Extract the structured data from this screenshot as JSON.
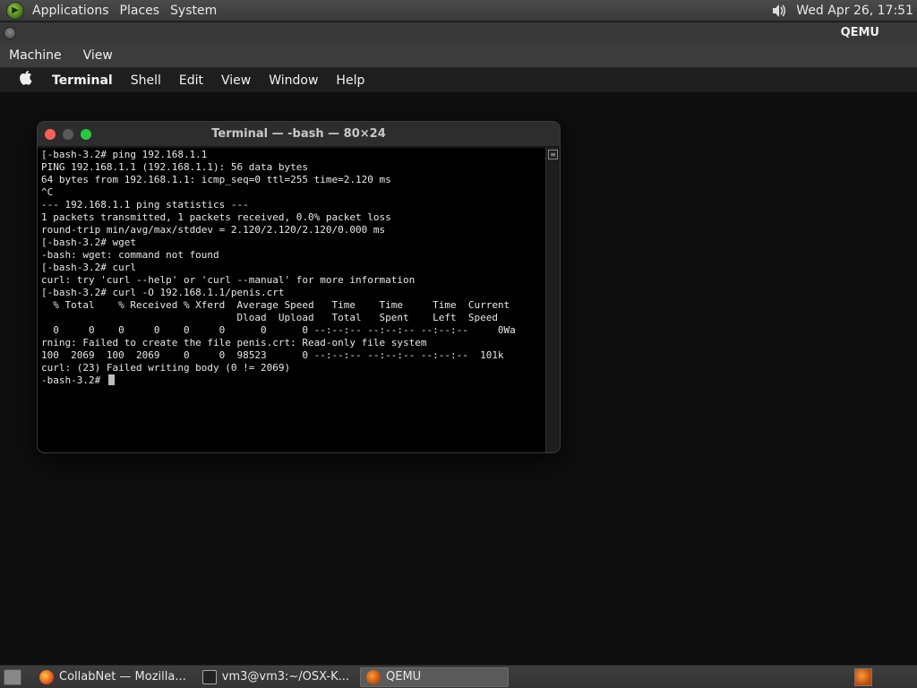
{
  "gnome_panel": {
    "menus": [
      "Applications",
      "Places",
      "System"
    ],
    "clock": "Wed Apr 26, 17:51"
  },
  "qemu": {
    "title": "QEMU",
    "menu": [
      "Machine",
      "View"
    ]
  },
  "mac_menubar": {
    "app_name": "Terminal",
    "items": [
      "Shell",
      "Edit",
      "Window",
      "Help"
    ],
    "view_label": "View"
  },
  "terminal": {
    "title": "Terminal — -bash — 80×24",
    "output": "[-bash-3.2# ping 192.168.1.1\nPING 192.168.1.1 (192.168.1.1): 56 data bytes\n64 bytes from 192.168.1.1: icmp_seq=0 ttl=255 time=2.120 ms\n^C\n--- 192.168.1.1 ping statistics ---\n1 packets transmitted, 1 packets received, 0.0% packet loss\nround-trip min/avg/max/stddev = 2.120/2.120/2.120/0.000 ms\n[-bash-3.2# wget\n-bash: wget: command not found\n[-bash-3.2# curl\ncurl: try 'curl --help' or 'curl --manual' for more information\n[-bash-3.2# curl -O 192.168.1.1/penis.crt\n  % Total    % Received % Xferd  Average Speed   Time    Time     Time  Current\n                                 Dload  Upload   Total   Spent    Left  Speed\n  0     0    0     0    0     0      0      0 --:--:-- --:--:-- --:--:--     0Wa\nrning: Failed to create the file penis.crt: Read-only file system\n100  2069  100  2069    0     0  98523      0 --:--:-- --:--:-- --:--:--  101k\ncurl: (23) Failed writing body (0 != 2069)\n-bash-3.2# "
  },
  "taskbar": {
    "tasks": [
      {
        "label": "CollabNet — Mozilla...",
        "icon": "firefox-icon"
      },
      {
        "label": "vm3@vm3:~/OSX-K...",
        "icon": "terminal-icon"
      },
      {
        "label": "QEMU",
        "icon": "qemu-icon"
      }
    ]
  }
}
